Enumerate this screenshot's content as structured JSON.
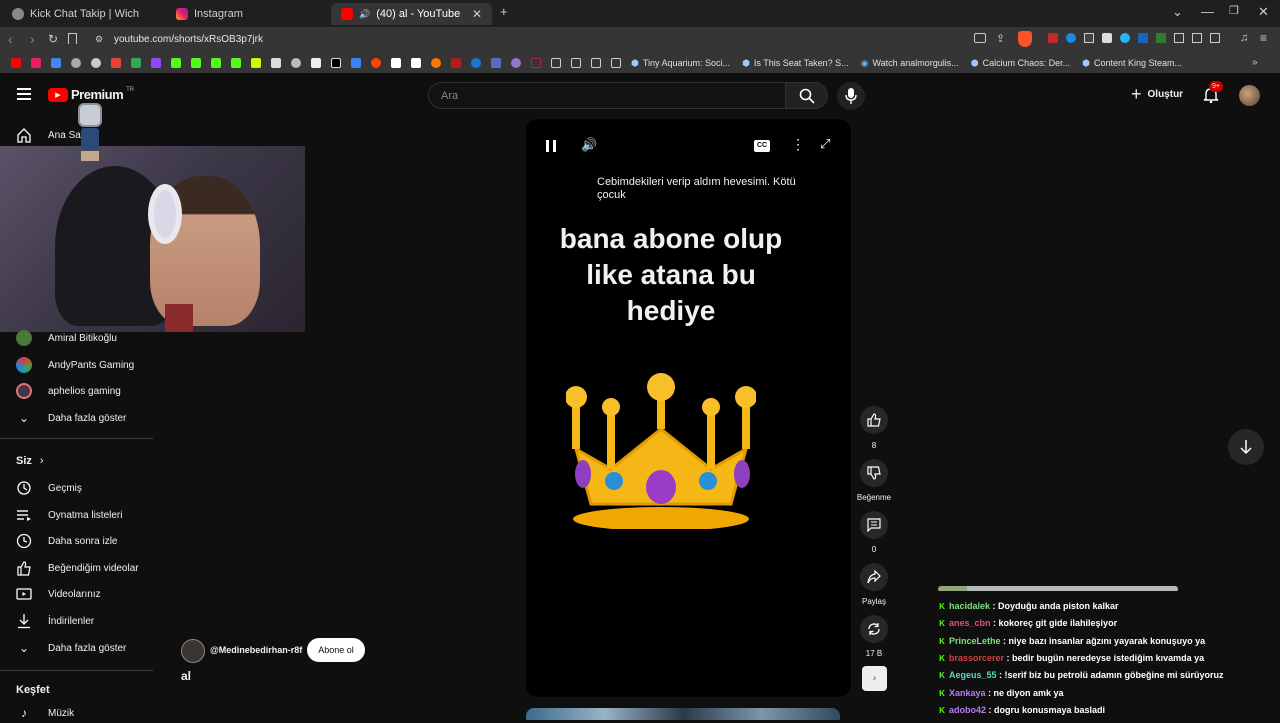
{
  "browser": {
    "tabs": [
      {
        "title": "Kick Chat Takip | Wich",
        "active": false
      },
      {
        "title": "Instagram",
        "active": false
      },
      {
        "title": "(40) al - YouTube",
        "active": true
      }
    ],
    "url": "youtube.com/shorts/xRsOB3p7jrk",
    "bookmarks": [
      "Tiny Aquarium: Soci...",
      "Is This Seat Taken? S...",
      "Watch analmorgulis...",
      "Calcium Chaos: Der...",
      "Content King Steam..."
    ]
  },
  "header": {
    "logo_text": "Premium",
    "logo_sup": "TR",
    "search_placeholder": "Ara",
    "create_label": "Oluştur",
    "notif_count": "9+"
  },
  "sidebar": {
    "home_label": "Ana Sayfa",
    "subscriptions": [
      {
        "label": "Amiral Bitikoğlu"
      },
      {
        "label": "AndyPants Gaming"
      },
      {
        "label": "aphelios gaming"
      }
    ],
    "show_more_1": "Daha fazla göster",
    "you_section": "Siz",
    "you_items": [
      {
        "label": "Geçmiş",
        "icon": "history-icon"
      },
      {
        "label": "Oynatma listeleri",
        "icon": "playlist-icon"
      },
      {
        "label": "Daha sonra izle",
        "icon": "clock-icon"
      },
      {
        "label": "Beğendiğim videolar",
        "icon": "thumbs-up-icon"
      },
      {
        "label": "Videolarınız",
        "icon": "video-icon"
      },
      {
        "label": "İndirilenler",
        "icon": "download-icon"
      }
    ],
    "show_more_2": "Daha fazla göster",
    "explore_section": "Keşfet",
    "music_label": "Müzik"
  },
  "short": {
    "caption": "Cebimdekileri verip aldım hevesimi. Kötü çocuk",
    "big_text_lines": [
      "bana abone olup",
      "like atana bu",
      "hediye"
    ],
    "emoji": "👑",
    "channel": "@Medinebedirhan-r8f",
    "subscribe_label": "Abone ol",
    "title": "al"
  },
  "actions": {
    "likes": "8",
    "dislike_label": "Beğenme",
    "comments": "0",
    "share_label": "Paylaş",
    "remix_count": "17 B"
  },
  "chat": [
    {
      "user": "hacidalek",
      "message": ": Doyduğu anda piston kalkar",
      "color": "#7ee07e"
    },
    {
      "user": "anes_cbn",
      "message": ": kokoreç git gide ilahileşiyor",
      "color": "#e0507a"
    },
    {
      "user": "PrinceLethe",
      "message": ": niye bazı insanlar ağzını yayarak konuşuyo ya",
      "color": "#7ee07e"
    },
    {
      "user": "brassorcerer",
      "message": ": bedir bugün neredeyse istediğim kıvamda ya",
      "color": "#d04040"
    },
    {
      "user": "Aegeus_55",
      "message": ": !serif biz bu petrolü adamın göbeğine mi sürüyoruz",
      "color": "#59d7c2"
    },
    {
      "user": "Xankaya",
      "message": ": ne diyon amk ya",
      "color": "#b37cf0"
    },
    {
      "user": "adobo42",
      "message": ": dogru konusmaya basladi",
      "color": "#b37cf0"
    }
  ],
  "colors": {
    "yt_red": "#ff0000",
    "bg": "#0f0f0f",
    "kick_green": "#53fc18"
  }
}
